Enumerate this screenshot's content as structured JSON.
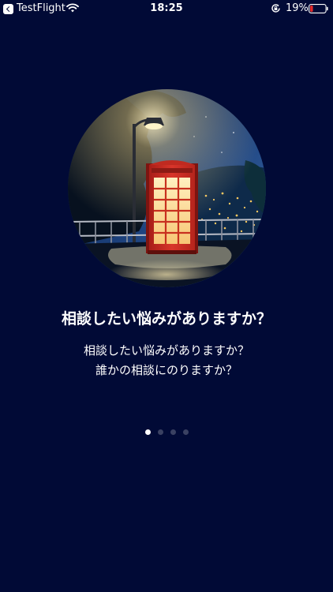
{
  "status_bar": {
    "back_app_label": "TestFlight",
    "time": "18:25",
    "battery_percent": "19%",
    "battery_level": 0.19,
    "icons": [
      "back-arrow-icon",
      "wifi-icon",
      "rotation-lock-icon",
      "battery-icon"
    ]
  },
  "onboarding": {
    "title": "相談したい悩みがありますか？",
    "description_lines": [
      "相談したい悩みがありますか？",
      "誰かの相談にのりますか？"
    ],
    "page_count": 4,
    "current_page": 1
  },
  "colors": {
    "background": "#010A36",
    "text": "#FFFFFF",
    "dot_active": "#FFFFFF",
    "dot_inactive": "#3A4162",
    "phone_booth": "#D8352A",
    "battery_low": "#E0282A"
  }
}
